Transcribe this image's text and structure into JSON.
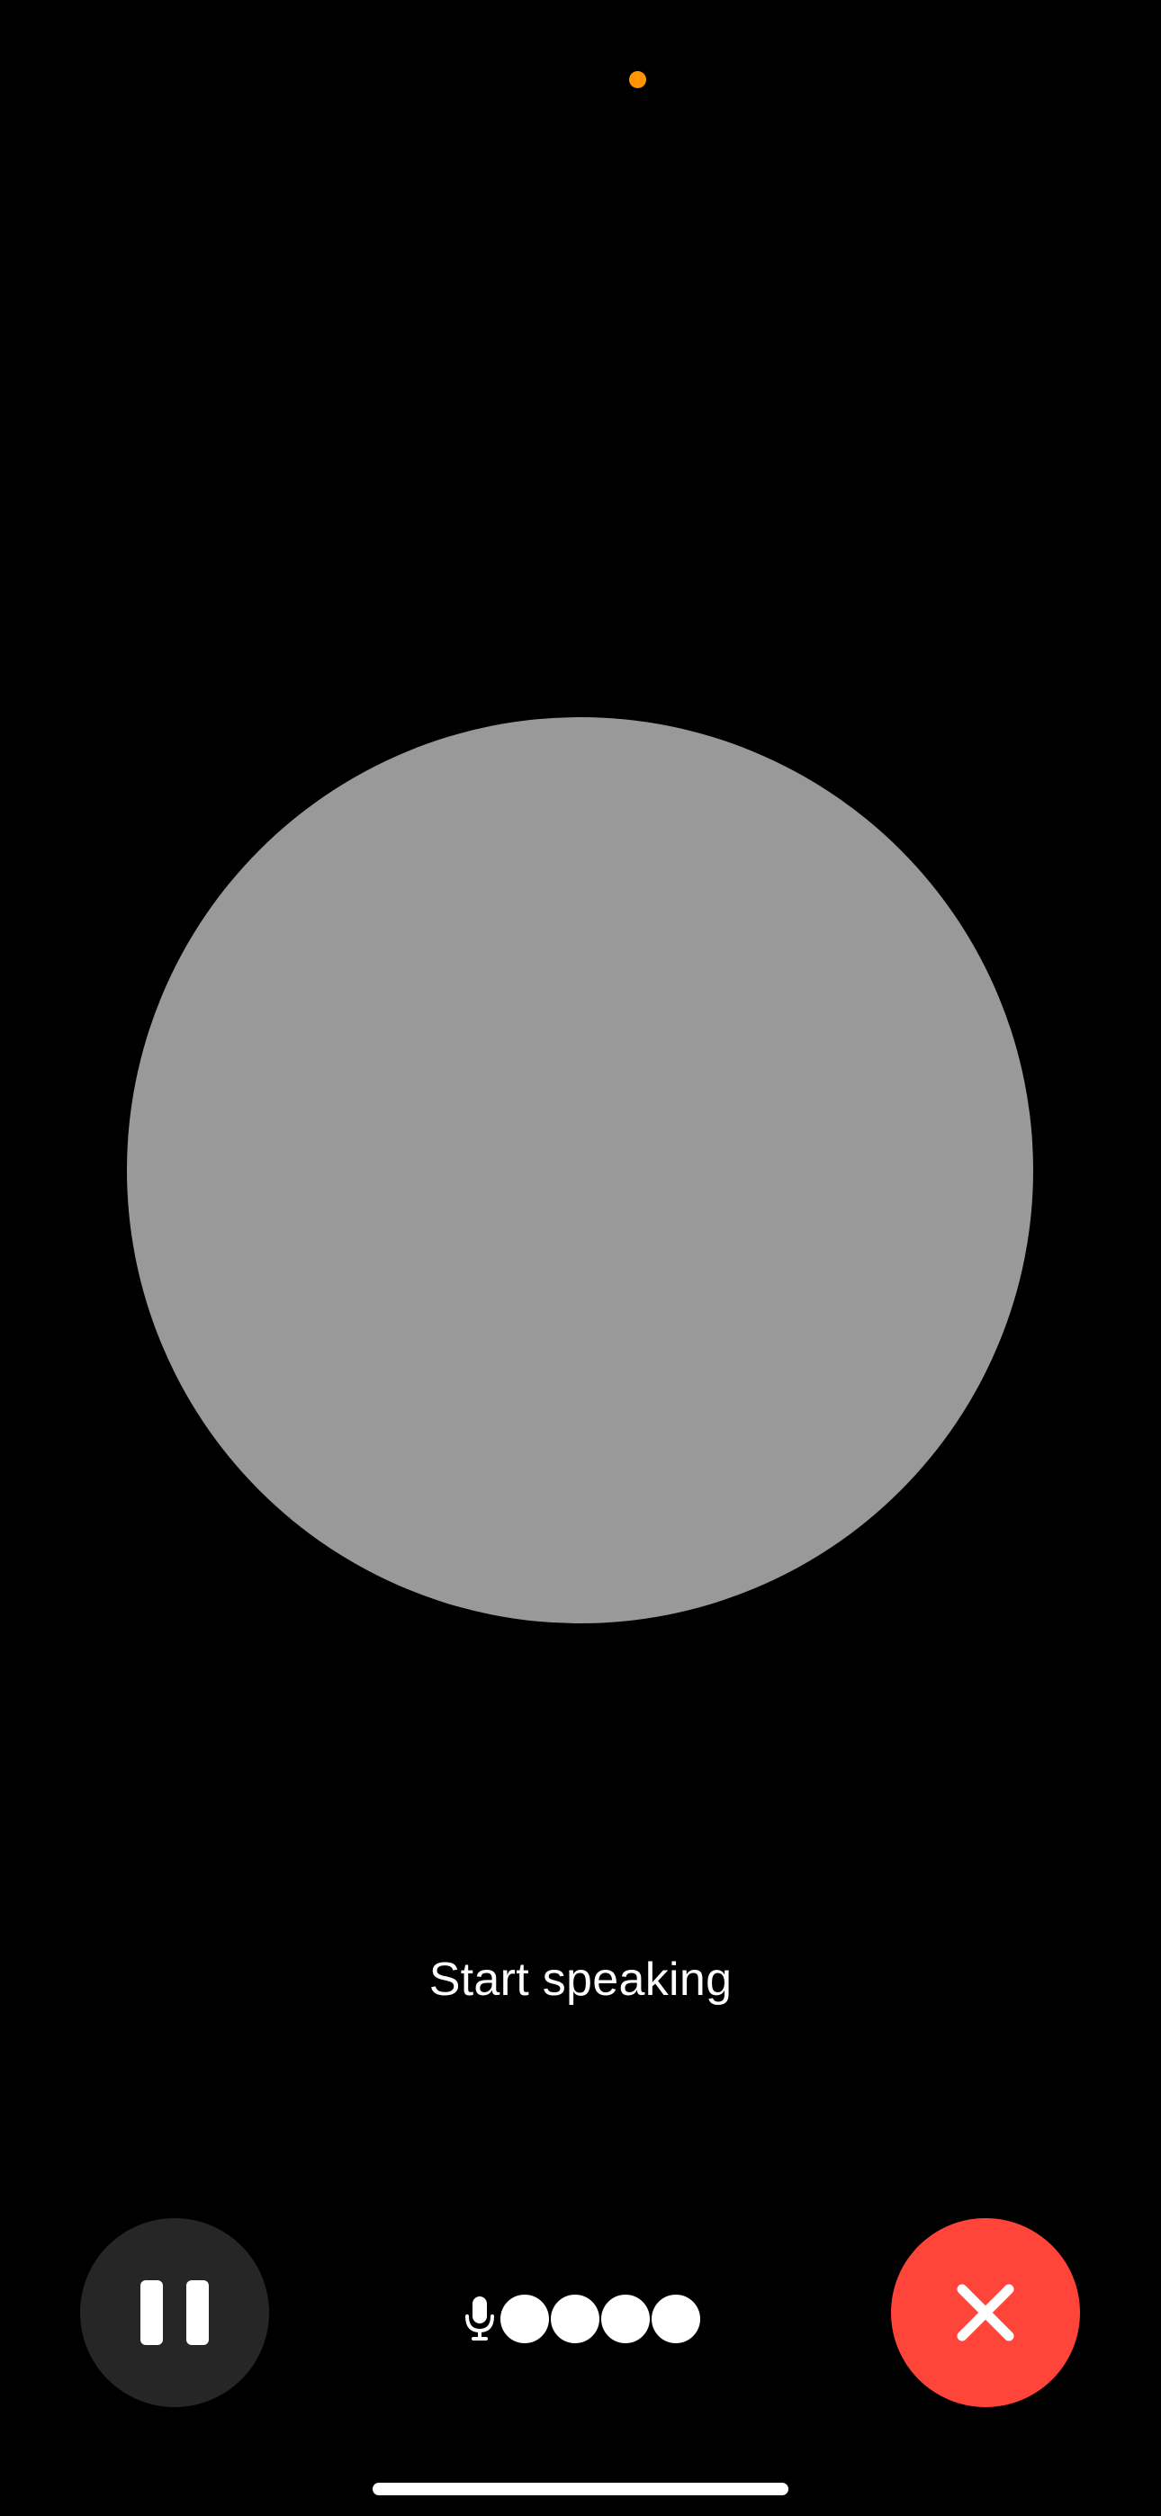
{
  "status": {
    "recording_dot_color": "#FF9500"
  },
  "orb": {
    "color": "#999999"
  },
  "prompt_text": "Start speaking",
  "controls": {
    "pause_icon": "pause-icon",
    "pause_button_color": "#262626",
    "end_icon": "close-icon",
    "end_button_color": "#FF453A",
    "mic_icon": "microphone-icon",
    "mic_level_dots": 4
  },
  "home_indicator_color": "#FFFFFF"
}
